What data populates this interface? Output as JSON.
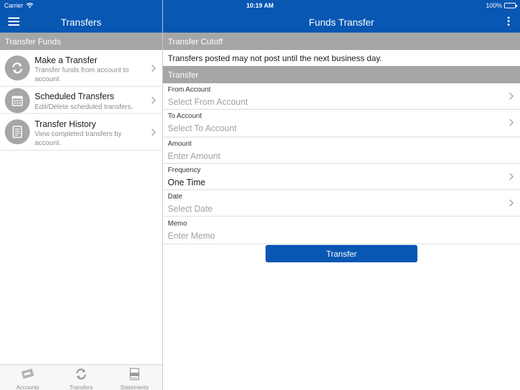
{
  "status_bar": {
    "carrier": "Carrier",
    "time": "10:19 AM",
    "battery": "100%"
  },
  "left_nav": {
    "title": "Transfers"
  },
  "right_nav": {
    "title": "Funds Transfer"
  },
  "left_pane": {
    "section_header": "Transfer Funds",
    "items": [
      {
        "title": "Make a Transfer",
        "subtitle": "Transfer funds from account to account.",
        "icon": "transfer-arrows-icon"
      },
      {
        "title": "Scheduled Transfers",
        "subtitle": "Edit/Delete scheduled transfers.",
        "icon": "calendar-icon"
      },
      {
        "title": "Transfer History",
        "subtitle": "View completed transfers by account.",
        "icon": "document-icon"
      }
    ]
  },
  "tab_bar": [
    {
      "label": "Accounts",
      "icon": "accounts-icon"
    },
    {
      "label": "Transfers",
      "icon": "transfers-icon"
    },
    {
      "label": "Statements",
      "icon": "statements-icon"
    }
  ],
  "cutoff": {
    "header": "Transfer Cutoff",
    "text": "Transfers posted may not post until the next business day."
  },
  "transfer_form": {
    "header": "Transfer",
    "from_account": {
      "label": "From Account",
      "placeholder": "Select From Account"
    },
    "to_account": {
      "label": "To Account",
      "placeholder": "Select To Account"
    },
    "amount": {
      "label": "Amount",
      "placeholder": "Enter Amount"
    },
    "frequency": {
      "label": "Frequency",
      "value": "One Time"
    },
    "date": {
      "label": "Date",
      "placeholder": "Select Date"
    },
    "memo": {
      "label": "Memo",
      "placeholder": "Enter Memo"
    },
    "submit_label": "Transfer"
  },
  "colors": {
    "brand_blue": "#0857b3",
    "section_gray": "#a6a6a6"
  }
}
